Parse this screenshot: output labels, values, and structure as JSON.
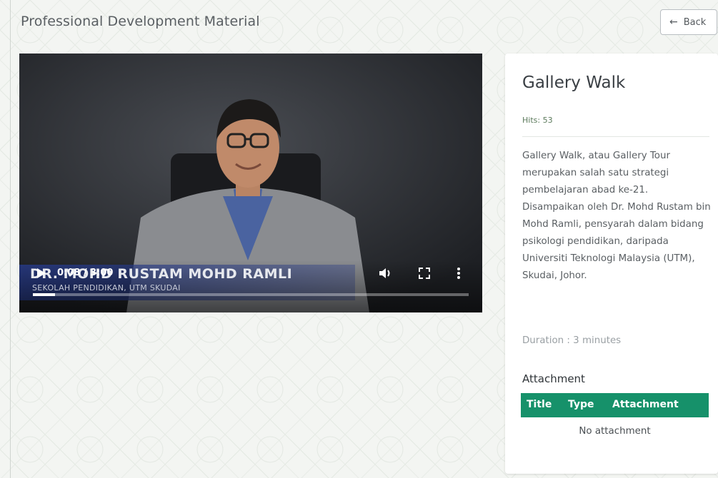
{
  "header": {
    "title": "Professional Development Material",
    "back_label": "Back"
  },
  "video": {
    "time_display": "0:08 / 3:00",
    "speaker_name": "DR. MOHD RUSTAM MOHD RAMLI",
    "speaker_affiliation": "SEKOLAH PENDIDIKAN, UTM SKUDAI",
    "progress_fraction": 0.05
  },
  "material": {
    "title": "Gallery Walk",
    "hits": "Hits: 53",
    "description": "Gallery Walk, atau Gallery Tour merupakan salah satu strategi pembelajaran abad ke-21. Disampaikan oleh Dr. Mohd Rustam bin Mohd Ramli, pensyarah dalam bidang psikologi pendidikan, daripada Universiti Teknologi Malaysia (UTM), Skudai, Johor.",
    "duration": "Duration : 3 minutes"
  },
  "attachments": {
    "heading": "Attachment",
    "columns": [
      "Title",
      "Type",
      "Attachment"
    ],
    "empty_text": "No attachment"
  },
  "colors": {
    "accent_green": "#16916a",
    "page_bg": "#f3f5f2",
    "title_text": "#5a5f63"
  },
  "icons": {
    "back": "arrow-left-icon",
    "play": "play-icon",
    "volume": "volume-icon",
    "fullscreen": "fullscreen-icon",
    "more": "more-vertical-icon"
  }
}
